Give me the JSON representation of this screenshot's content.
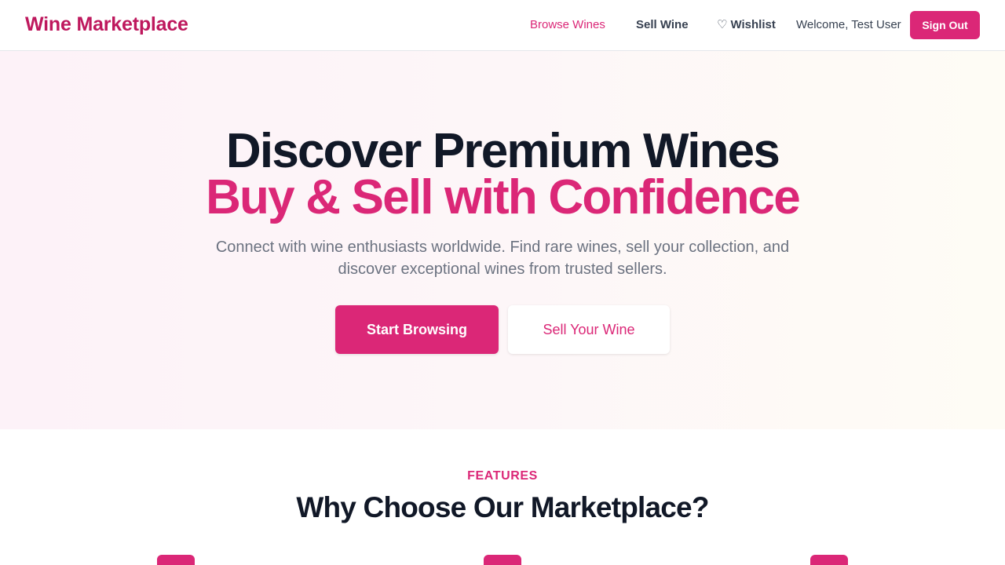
{
  "header": {
    "brand": "Wine Marketplace",
    "nav": {
      "browse": "Browse Wines",
      "sell": "Sell Wine",
      "wishlist": "Wishlist"
    },
    "welcome": "Welcome, Test User",
    "sign_out": "Sign Out",
    "icons": {
      "wishlist": "heart-outline-icon"
    }
  },
  "hero": {
    "title_line1": "Discover Premium Wines",
    "title_line2": "Buy & Sell with Confidence",
    "subtitle": "Connect with wine enthusiasts worldwide. Find rare wines, sell your collection, and discover exceptional wines from trusted sellers.",
    "primary_cta": "Start Browsing",
    "secondary_cta": "Sell Your Wine"
  },
  "features": {
    "eyebrow": "FEATURES",
    "title": "Why Choose Our Marketplace?",
    "icon_count_visible": 3
  },
  "colors": {
    "accent": "#db2777",
    "brand": "#be185d",
    "heading": "#111827",
    "muted_text": "#6b7280"
  }
}
